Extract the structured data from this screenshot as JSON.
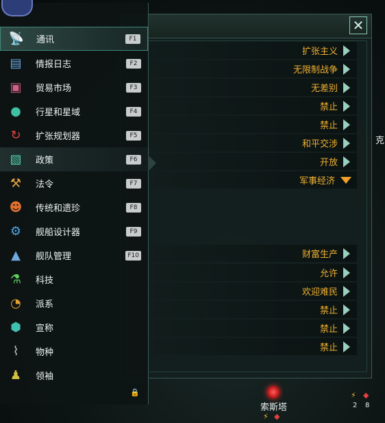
{
  "policies_window": {
    "rows": [
      {
        "value": "扩张主义"
      },
      {
        "value": "无限制战争"
      },
      {
        "value": "无差别"
      },
      {
        "value": "禁止"
      },
      {
        "value": "禁止"
      },
      {
        "value": "和平交涉"
      },
      {
        "value": "开放"
      },
      {
        "value": "军事经济"
      },
      {
        "value": "财富生产"
      },
      {
        "value": "允许"
      },
      {
        "value": "欢迎难民"
      },
      {
        "value": "禁止"
      },
      {
        "value": "禁止"
      },
      {
        "value": "禁止"
      }
    ],
    "close_symbol": "✕",
    "edge_text": "克"
  },
  "map": {
    "system_name": "索斯塔",
    "resources": [
      {
        "icon": "energy-icon",
        "count": "2"
      },
      {
        "icon": "minerals-icon",
        "count": "8"
      }
    ]
  },
  "main_menu": {
    "items": [
      {
        "label": "通讯",
        "hotkey": "F1",
        "icon": "communications-icon",
        "state": "selected"
      },
      {
        "label": "情报日志",
        "hotkey": "F2",
        "icon": "situation-log-icon"
      },
      {
        "label": "贸易市场",
        "hotkey": "F3",
        "icon": "market-icon"
      },
      {
        "label": "行星和星域",
        "hotkey": "F4",
        "icon": "planets-icon"
      },
      {
        "label": "扩张规划器",
        "hotkey": "F5",
        "icon": "expansion-planner-icon"
      },
      {
        "label": "政策",
        "hotkey": "F6",
        "icon": "policies-icon",
        "state": "current"
      },
      {
        "label": "法令",
        "hotkey": "F7",
        "icon": "edicts-icon"
      },
      {
        "label": "传统和遗珍",
        "hotkey": "F8",
        "icon": "traditions-icon"
      },
      {
        "label": "舰船设计器",
        "hotkey": "F9",
        "icon": "ship-designer-icon"
      },
      {
        "label": "舰队管理",
        "hotkey": "F10",
        "icon": "fleet-manager-icon"
      },
      {
        "label": "科技",
        "hotkey": "",
        "icon": "technology-icon"
      },
      {
        "label": "派系",
        "hotkey": "",
        "icon": "factions-icon"
      },
      {
        "label": "宣称",
        "hotkey": "",
        "icon": "claims-icon"
      },
      {
        "label": "物种",
        "hotkey": "",
        "icon": "species-icon"
      },
      {
        "label": "领袖",
        "hotkey": "",
        "icon": "leaders-icon"
      }
    ]
  },
  "colors": {
    "accent_teal": "#3e8a78",
    "policy_value": "#f0b030",
    "hotkey_bg": "#c8cccc"
  }
}
